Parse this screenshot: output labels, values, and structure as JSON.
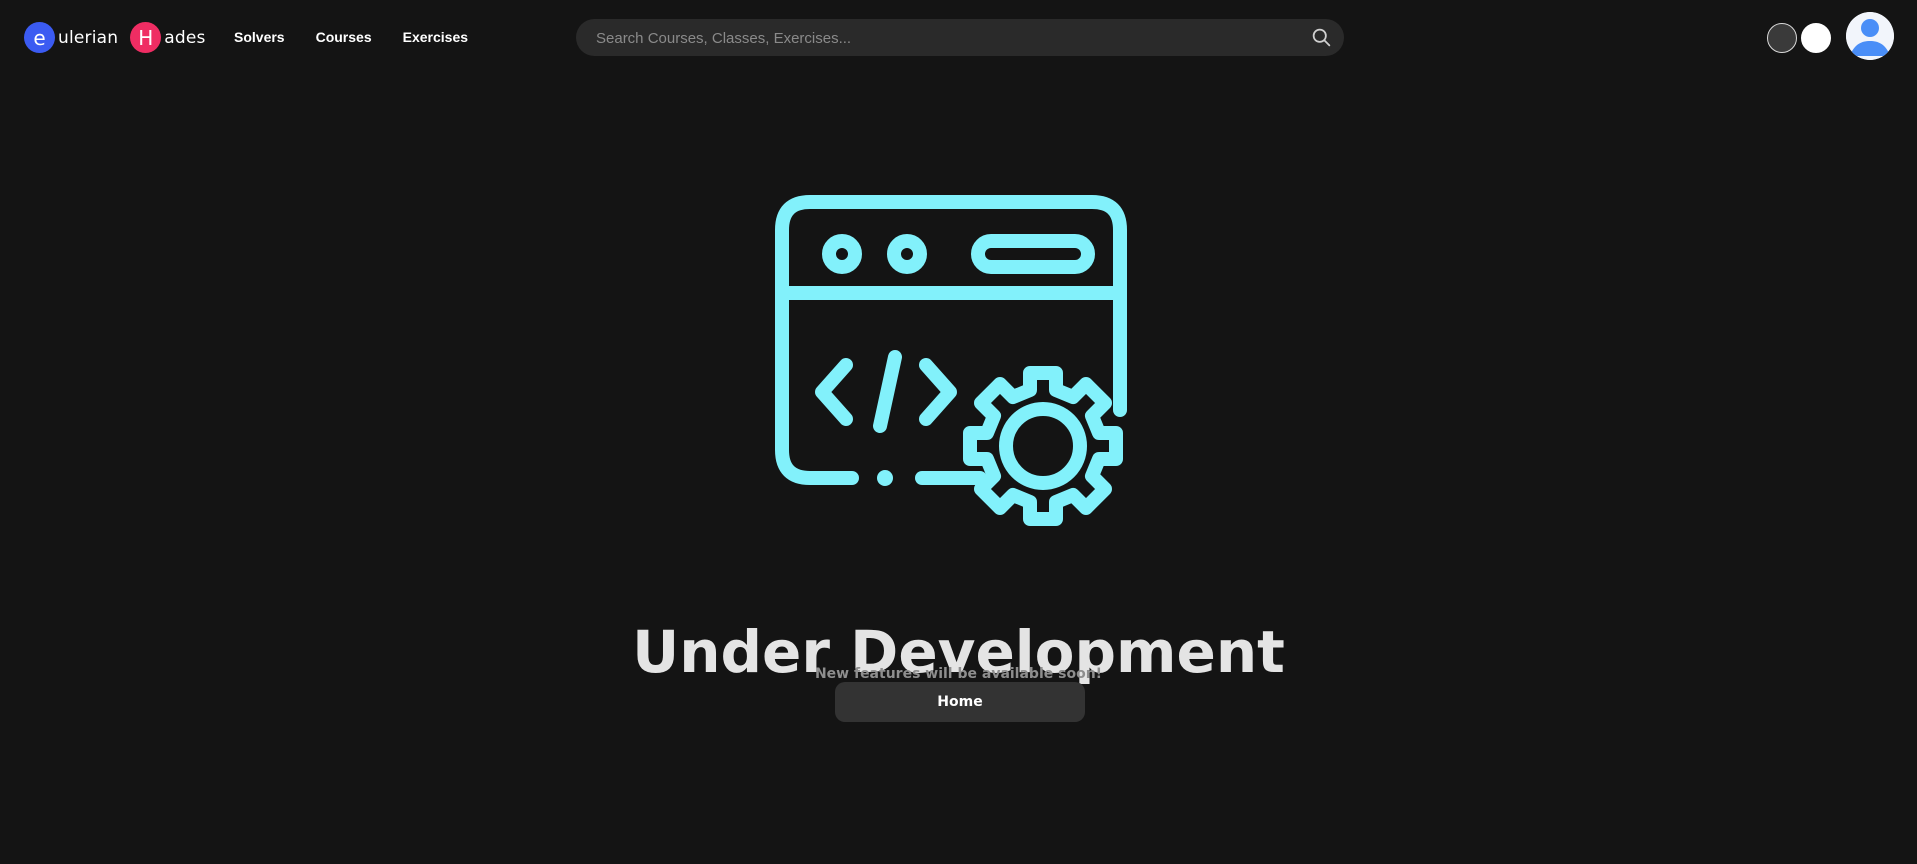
{
  "brand": {
    "badge_e": "e",
    "word_e": "ulerian",
    "badge_h": "H",
    "word_h": "ades",
    "color_e": "#3b5bf2",
    "color_h": "#ef2d63"
  },
  "nav": {
    "items": [
      {
        "label": "Solvers"
      },
      {
        "label": "Courses"
      },
      {
        "label": "Exercises"
      }
    ]
  },
  "search": {
    "placeholder": "Search Courses, Classes, Exercises...",
    "value": "",
    "icon": "search-icon"
  },
  "theme": {
    "options": [
      "dark",
      "light"
    ]
  },
  "user": {
    "avatar_icon": "user-avatar-icon"
  },
  "hero": {
    "illustration_icon": "web-development-settings-icon",
    "accent_color": "#82f1fb",
    "title": "Under Development",
    "subtitle": "New features will be available soon!",
    "button_label": "Home"
  }
}
